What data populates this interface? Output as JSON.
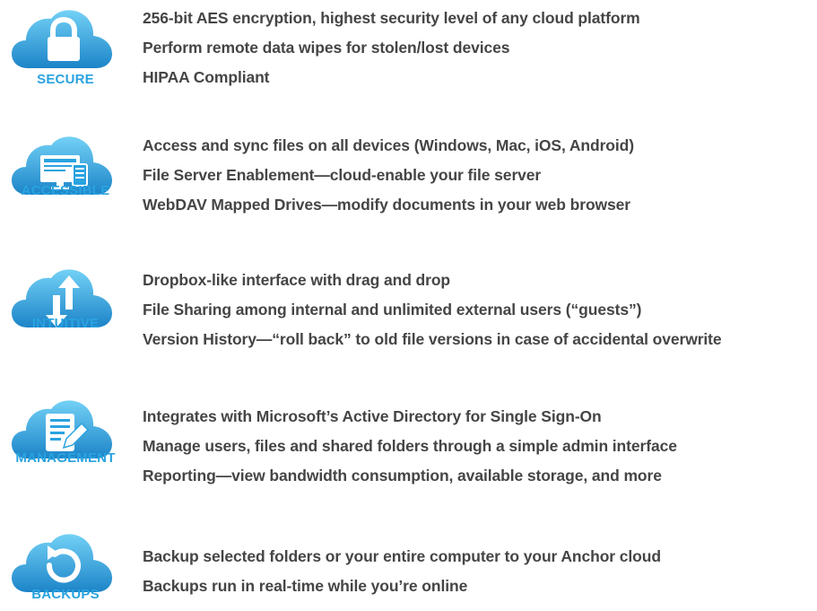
{
  "colors": {
    "cloud_light": "#6fcdf4",
    "cloud_dark": "#1e86c9",
    "label": "#29a3e0",
    "text": "#454545"
  },
  "features": [
    {
      "id": "secure",
      "label": "SECURE",
      "icon": "padlock-icon",
      "lines": [
        "256-bit AES encryption, highest security level of any cloud platform",
        "Perform remote data wipes for stolen/lost devices",
        "HIPAA Compliant"
      ]
    },
    {
      "id": "accessible",
      "label": "ACCESSIBLE",
      "icon": "devices-icon",
      "lines": [
        "Access and sync files on all devices (Windows, Mac, iOS, Android)",
        "File Server Enablement—cloud-enable your file server",
        "WebDAV Mapped Drives—modify documents in your web browser"
      ]
    },
    {
      "id": "intuitive",
      "label": "INTUITIVE",
      "icon": "up-down-arrows-icon",
      "lines": [
        "Dropbox-like interface with drag and drop",
        "File Sharing among internal and unlimited external users (“guests”)",
        "Version History—“roll back” to old file versions in case of accidental overwrite"
      ]
    },
    {
      "id": "management",
      "label": "MANAGEMENT",
      "icon": "document-edit-icon",
      "lines": [
        "Integrates with Microsoft’s Active Directory for Single Sign-On",
        "Manage users, files and shared folders through a simple admin interface",
        "Reporting—view bandwidth consumption, available storage, and more"
      ]
    },
    {
      "id": "backups",
      "label": "BACKUPS",
      "icon": "refresh-icon",
      "lines": [
        "Backup selected folders or your entire computer to your Anchor cloud",
        "Backups run in real-time while you’re online"
      ]
    }
  ]
}
